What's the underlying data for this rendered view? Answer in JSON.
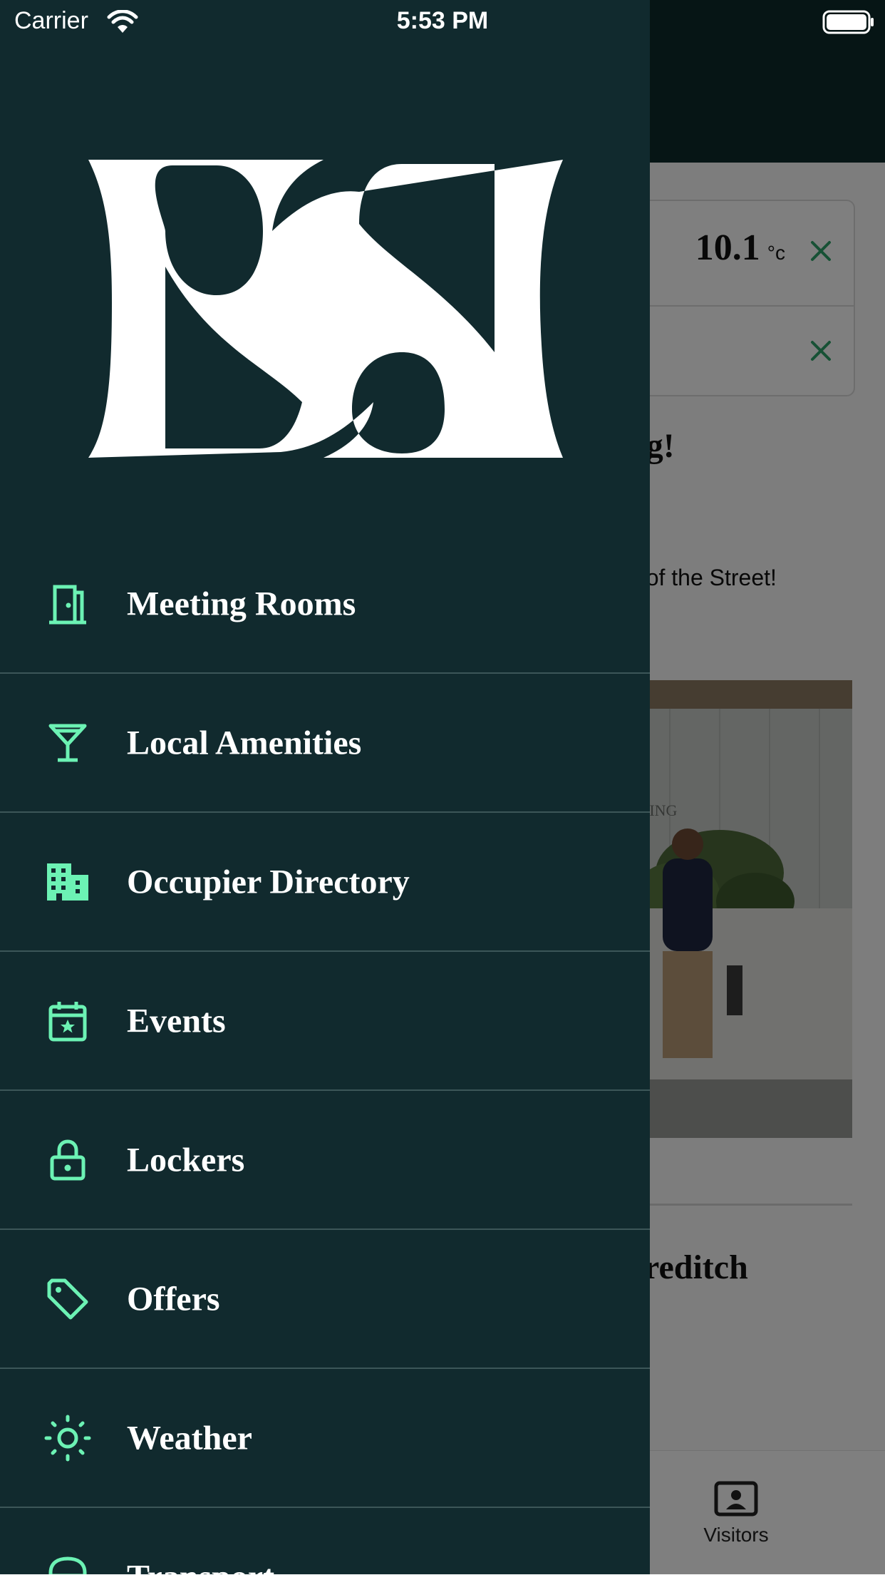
{
  "status_bar": {
    "carrier": "Carrier",
    "time": "5:53 PM",
    "wifi_icon": "wifi-icon",
    "battery_icon": "battery-full-icon"
  },
  "background_page": {
    "weather_card": {
      "temperature": "10.1",
      "unit": "°c",
      "dismiss_icon": "close-icon"
    },
    "heading_partial": "ng!",
    "subtext_partial": "e of the Street!",
    "photo_caption_partial": "LDING",
    "heading2_partial": "oreditch",
    "tabbar": {
      "visitors_label": "Visitors",
      "visitors_icon": "visitor-badge-icon"
    }
  },
  "drawer": {
    "logo_icon": "bb-monogram-logo",
    "menu": [
      {
        "label": "Meeting Rooms",
        "icon": "door-icon"
      },
      {
        "label": "Local Amenities",
        "icon": "cocktail-glass-icon"
      },
      {
        "label": "Occupier Directory",
        "icon": "building-icon"
      },
      {
        "label": "Events",
        "icon": "calendar-star-icon"
      },
      {
        "label": "Lockers",
        "icon": "lock-icon"
      },
      {
        "label": "Offers",
        "icon": "tag-icon"
      },
      {
        "label": "Weather",
        "icon": "sun-icon"
      },
      {
        "label": "Transport",
        "icon": "transport-icon"
      }
    ]
  },
  "colors": {
    "drawer_bg": "#112a2e",
    "accent": "#6cf2b4",
    "divider": "#3c5658",
    "text": "#ffffff"
  }
}
